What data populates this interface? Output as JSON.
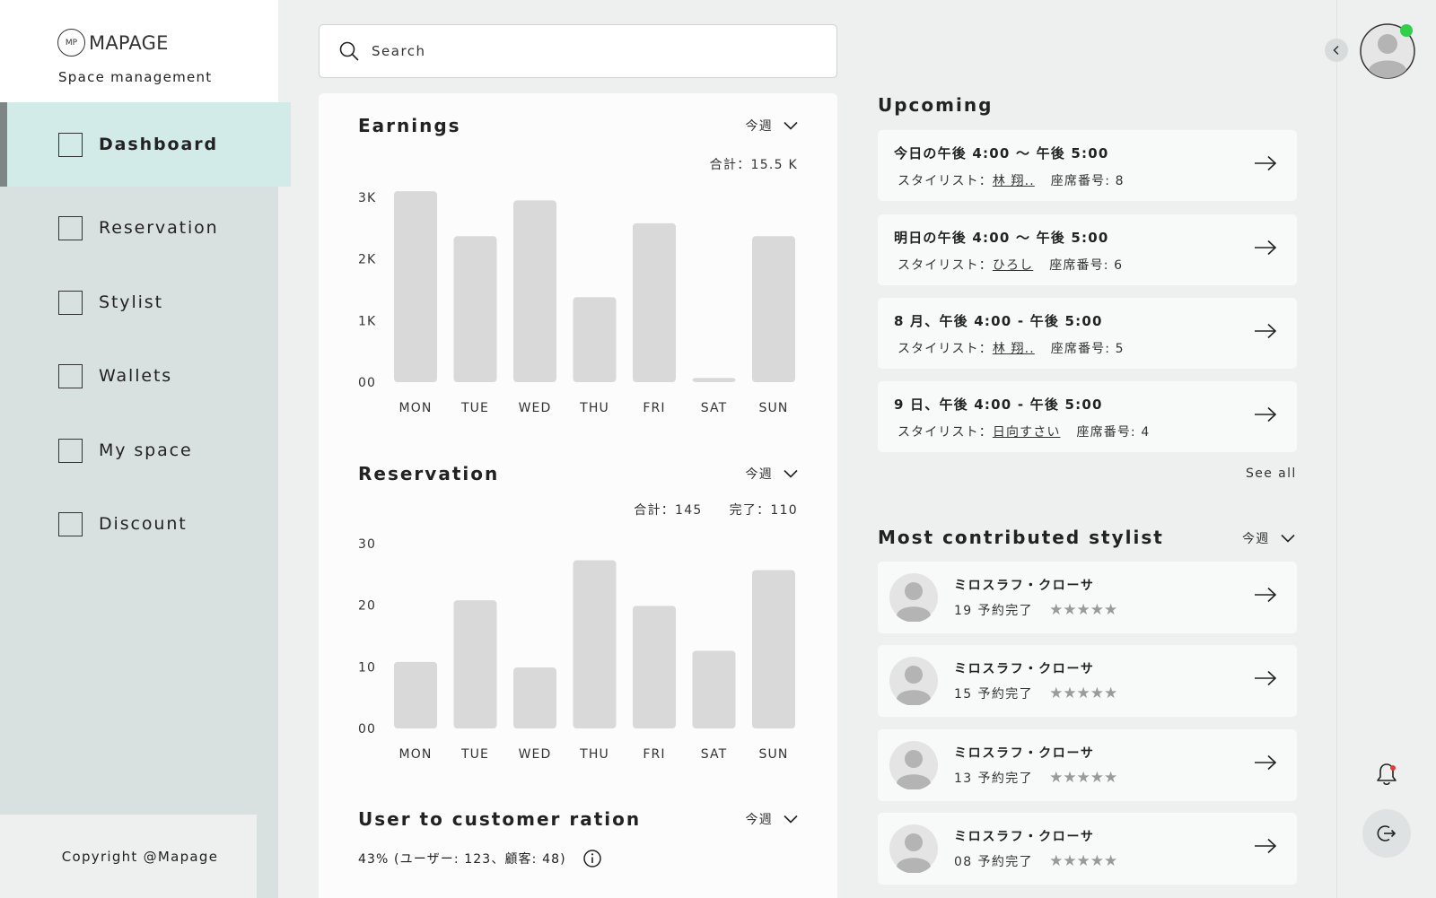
{
  "brand": {
    "logo_text": "MAPAGE",
    "logo_mark": "MP",
    "subtitle": "Space management"
  },
  "nav": [
    {
      "label": "Dashboard",
      "active": true
    },
    {
      "label": "Reservation"
    },
    {
      "label": "Stylist"
    },
    {
      "label": "Wallets"
    },
    {
      "label": "My space"
    },
    {
      "label": "Discount"
    }
  ],
  "footer": {
    "copyright": "Copyright @Mapage"
  },
  "search": {
    "placeholder": "Search"
  },
  "earnings": {
    "title": "Earnings",
    "period": "今週",
    "total": "合計：15.5 K"
  },
  "reservation": {
    "title": "Reservation",
    "period": "今週",
    "total": "合計：145",
    "done": "完了：110"
  },
  "ratio": {
    "title": "User to customer ration",
    "period": "今週",
    "text": "43% (ユーザー: 123、顧客: 48)"
  },
  "chart_data": [
    {
      "type": "bar",
      "title": "Earnings",
      "categories": [
        "MON",
        "TUE",
        "WED",
        "THU",
        "FRI",
        "SAT",
        "SUN"
      ],
      "values": [
        3100,
        2370,
        2950,
        1380,
        2580,
        70,
        2370
      ],
      "yticks": [
        "3K",
        "2K",
        "1K",
        "00"
      ],
      "ylim": [
        0,
        3000
      ]
    },
    {
      "type": "bar",
      "title": "Reservation",
      "categories": [
        "MON",
        "TUE",
        "WED",
        "THU",
        "FRI",
        "SAT",
        "SUN"
      ],
      "values": [
        10.8,
        20.8,
        9.9,
        27.3,
        19.9,
        12.6,
        25.7
      ],
      "yticks": [
        "30",
        "20",
        "10",
        "00"
      ],
      "ylim": [
        0,
        30
      ]
    }
  ],
  "upcoming": {
    "title": "Upcoming",
    "see_all": "See all",
    "items": [
      {
        "time": "今日の午後 4:00 〜 午後 5:00",
        "stylist_label": "スタイリスト：",
        "stylist": "林 翔..",
        "seat": "座席番号: 8"
      },
      {
        "time": "明日の午後 4:00 〜 午後 5:00",
        "stylist_label": "スタイリスト：",
        "stylist": "ひろし",
        "seat": "座席番号: 6"
      },
      {
        "time": "8 月、午後 4:00 - 午後 5:00",
        "stylist_label": "スタイリスト：",
        "stylist": "林 翔..",
        "seat": "座席番号: 5"
      },
      {
        "time": "9 日、午後 4:00 - 午後 5:00",
        "stylist_label": "スタイリスト：",
        "stylist": "日向すさい",
        "seat": "座席番号: 4"
      }
    ]
  },
  "top_stylists": {
    "title": "Most contributed stylist",
    "period": "今週",
    "items": [
      {
        "name": "ミロスラフ・クローサ",
        "count": "19 予約完了",
        "stars": "★★★★★"
      },
      {
        "name": "ミロスラフ・クローサ",
        "count": "15 予約完了",
        "stars": "★★★★★"
      },
      {
        "name": "ミロスラフ・クローサ",
        "count": "13 予約完了",
        "stars": "★★★★★"
      },
      {
        "name": "ミロスラフ・クローサ",
        "count": "08 予約完了",
        "stars": "★★★★★"
      }
    ]
  },
  "colors": {
    "sidebar": "#d9e1e0",
    "active_nav": "#d3ebe8",
    "bar": "#d9d9d9",
    "online": "#2fd14a",
    "notification": "#e53935"
  },
  "icons": {
    "search": "search-icon",
    "chevron": "chevron-down-icon",
    "arrow": "arrow-right-icon",
    "info": "info-icon",
    "bell": "bell-icon",
    "logout": "logout-icon",
    "collapse": "chevron-left-icon"
  }
}
